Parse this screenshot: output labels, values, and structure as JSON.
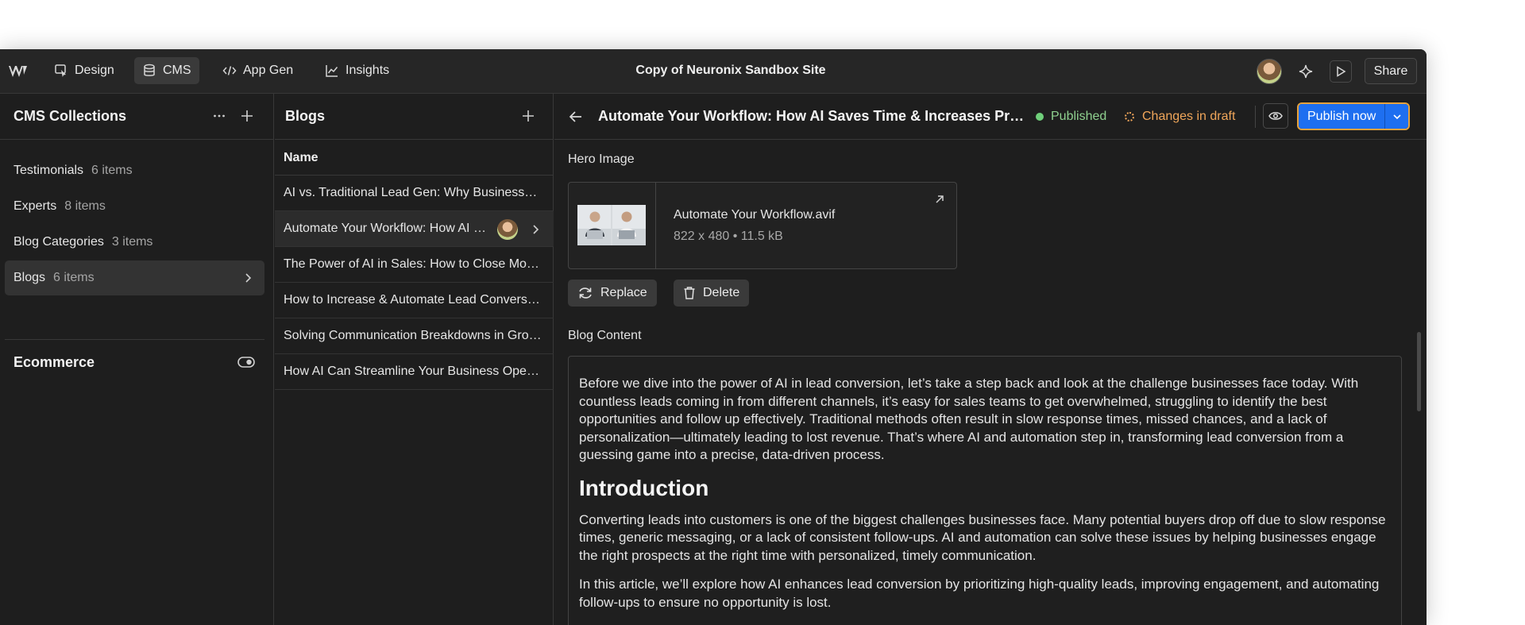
{
  "app": {
    "site_title": "Copy of Neuronix Sandbox Site",
    "share_label": "Share",
    "nav": [
      {
        "label": "Design",
        "icon": "designer-cursor-icon"
      },
      {
        "label": "CMS",
        "icon": "database-icon"
      },
      {
        "label": "App Gen",
        "icon": "code-icon"
      },
      {
        "label": "Insights",
        "icon": "chart-line-icon"
      }
    ]
  },
  "collections": {
    "title": "CMS Collections",
    "items": [
      {
        "label": "Testimonials",
        "count": "6 items"
      },
      {
        "label": "Experts",
        "count": "8 items"
      },
      {
        "label": "Blog Categories",
        "count": "3 items"
      },
      {
        "label": "Blogs",
        "count": "6 items"
      }
    ],
    "ecommerce_label": "Ecommerce"
  },
  "blogs": {
    "title": "Blogs",
    "column_header": "Name",
    "rows": [
      "AI vs. Traditional Lead Gen: Why Businesses Are Switching",
      "Automate Your Workflow: How AI Saves Time",
      "The Power of AI in Sales: How to Close More Deals",
      "How to Increase & Automate Lead Conversion",
      "Solving Communication Breakdowns in Growing Teams",
      "How AI Can Streamline Your Business Operations"
    ]
  },
  "item": {
    "title": "Automate Your Workflow: How AI Saves Time & Increases Productivity",
    "status_published": "Published",
    "status_draft": "Changes in draft",
    "publish_label": "Publish now",
    "hero_label": "Hero Image",
    "file_name": "Automate Your Workflow.avif",
    "file_meta": "822 x 480 • 11.5 kB",
    "replace_label": "Replace",
    "delete_label": "Delete",
    "content_label": "Blog Content",
    "content": {
      "p1": "Before we dive into the power of AI in lead conversion, let’s take a step back and look at the challenge businesses face today. With countless leads coming in from different channels, it’s easy for sales teams to get overwhelmed, struggling to identify the best opportunities and follow up effectively. Traditional methods often result in slow response times, missed chances, and a lack of personalization—ultimately leading to lost revenue. That’s where AI and automation step in, transforming lead conversion from a guessing game into a precise, data-driven process.",
      "h2": "Introduction",
      "p2": "Converting leads into customers is one of the biggest challenges businesses face. Many potential buyers drop off due to slow response times, generic messaging, or a lack of consistent follow-ups. AI and automation can solve these issues by helping businesses engage the right prospects at the right time with personalized, timely communication.",
      "p3": "In this article, we’ll explore how AI enhances lead conversion by prioritizing high-quality leads, improving engagement, and automating follow-ups to ensure no opportunity is lost."
    }
  },
  "colors": {
    "accent_blue": "#1e6ff0",
    "published_green": "#6fcf7a",
    "draft_orange": "#f0a65a",
    "focus_outline": "#e6a23c"
  }
}
